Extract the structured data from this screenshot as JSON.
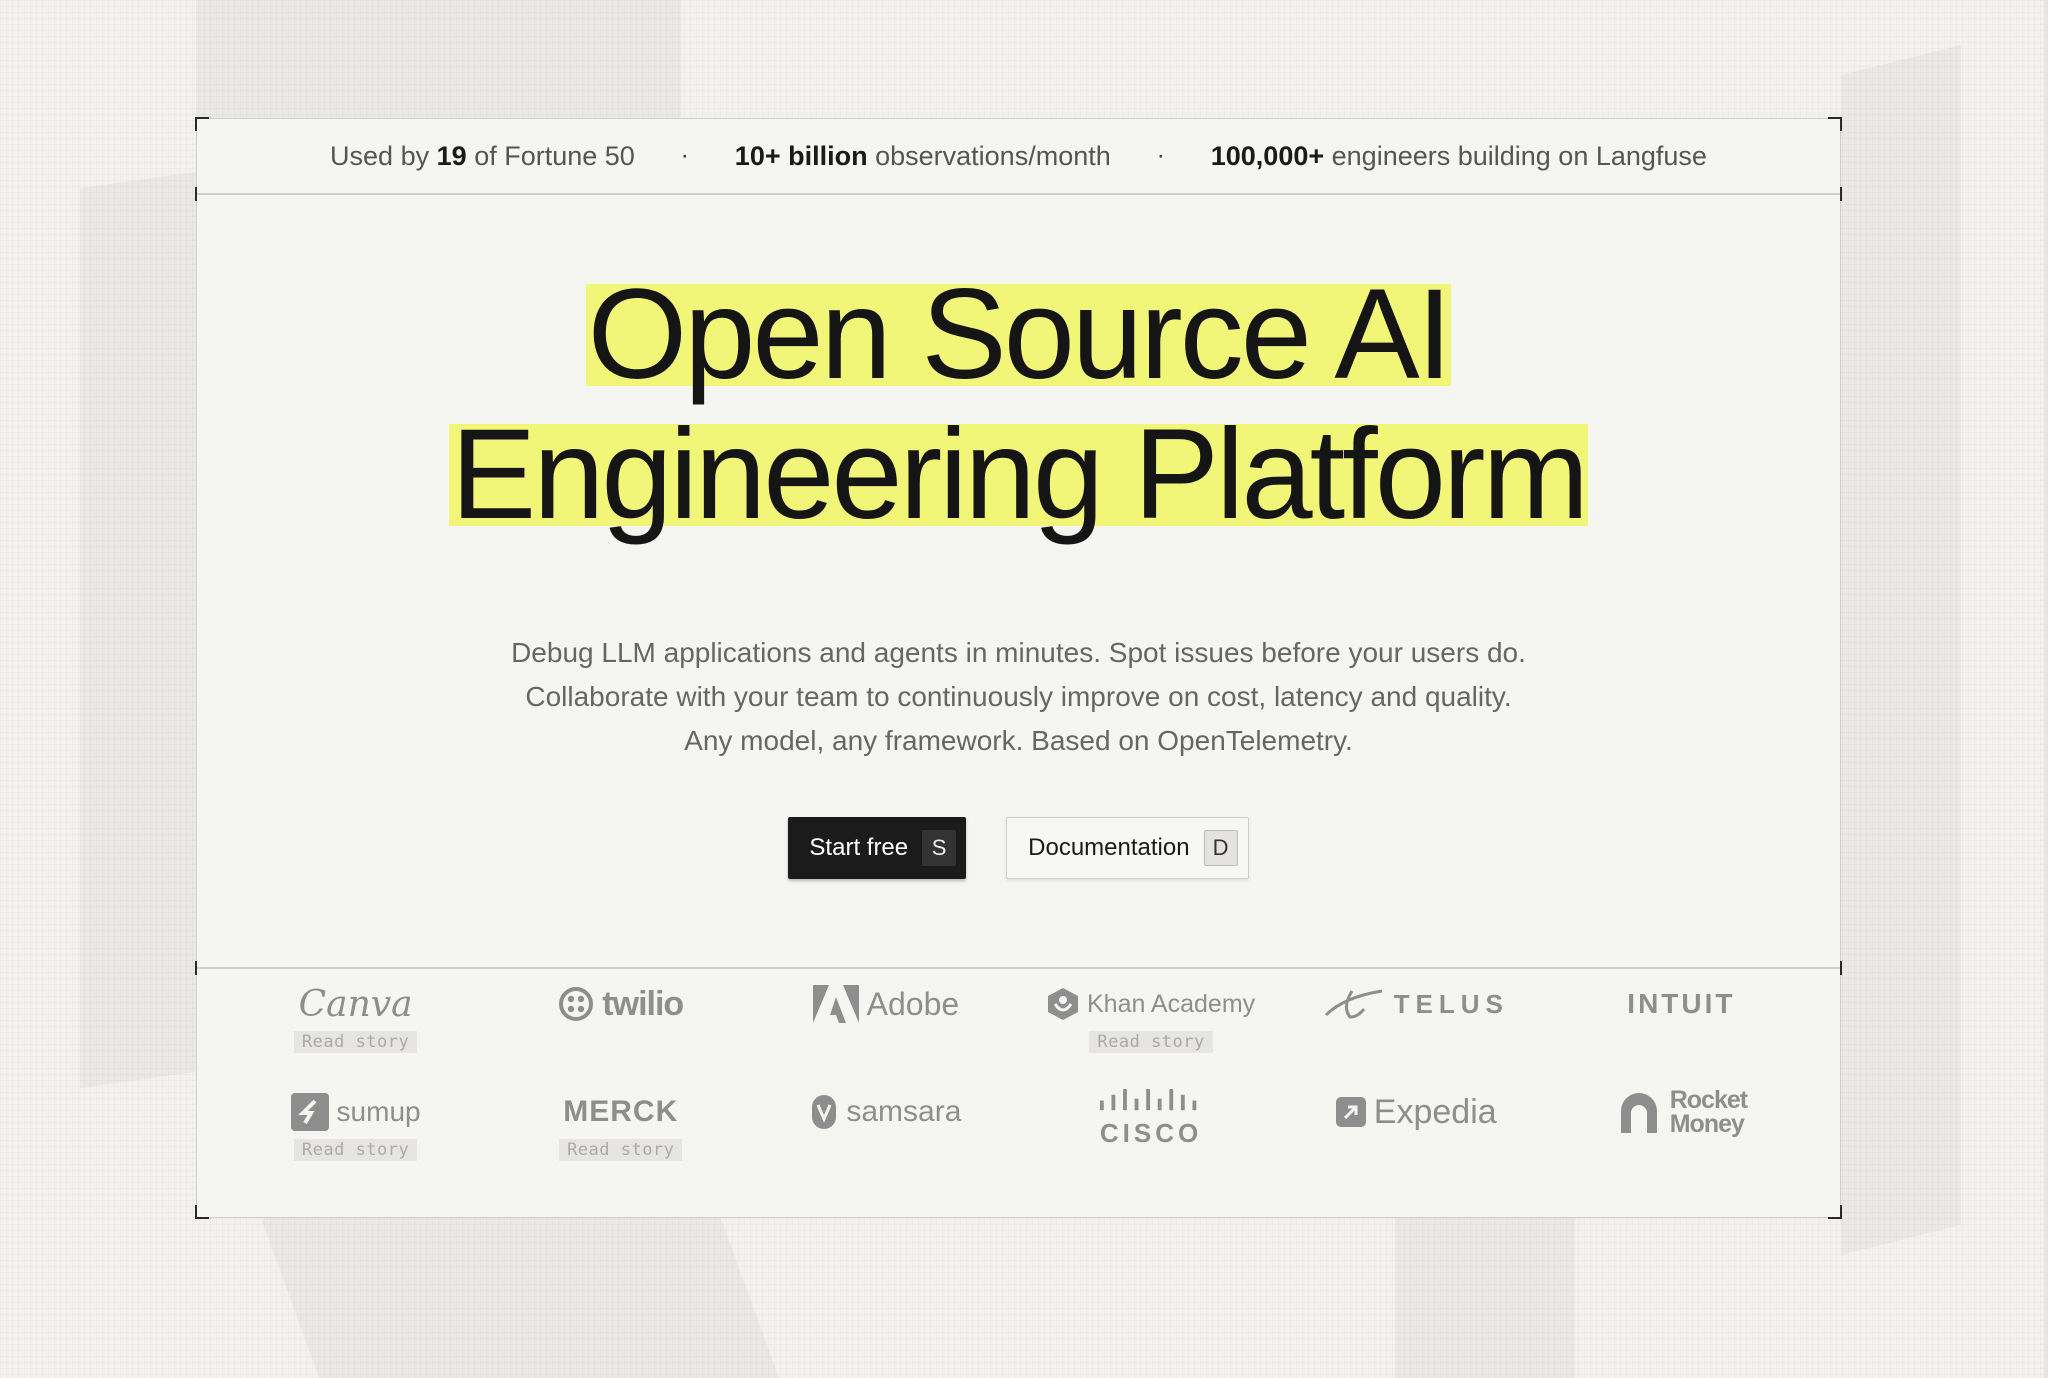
{
  "stats": {
    "item1_pre": "Used by",
    "item1_bold": "19",
    "item1_post": "of Fortune 50",
    "item2_bold": "10+ billion",
    "item2_post": "observations/month",
    "item3_bold": "100,000+",
    "item3_post": "engineers building on Langfuse",
    "separator": "·"
  },
  "hero": {
    "line1": "Open Source AI",
    "line2": "Engineering Platform",
    "sub1": "Debug LLM applications and agents in minutes. Spot issues before your users do.",
    "sub2": "Collaborate with your team to continuously improve on cost, latency and quality.",
    "sub3": "Any model, any framework. Based on OpenTelemetry.",
    "highlight_color": "#f1f578"
  },
  "ctas": {
    "start_label": "Start free",
    "start_key": "S",
    "docs_label": "Documentation",
    "docs_key": "D"
  },
  "logos": {
    "read_story": "Read story",
    "canva": "Canva",
    "twilio": "twilio",
    "adobe": "Adobe",
    "khan": "Khan Academy",
    "telus": "TELUS",
    "intuit": "INTUIT",
    "sumup": "sumup",
    "merck": "MERCK",
    "samsara": "samsara",
    "cisco": "CISCO",
    "expedia": "Expedia",
    "rocket1": "Rocket",
    "rocket2": "Money"
  }
}
